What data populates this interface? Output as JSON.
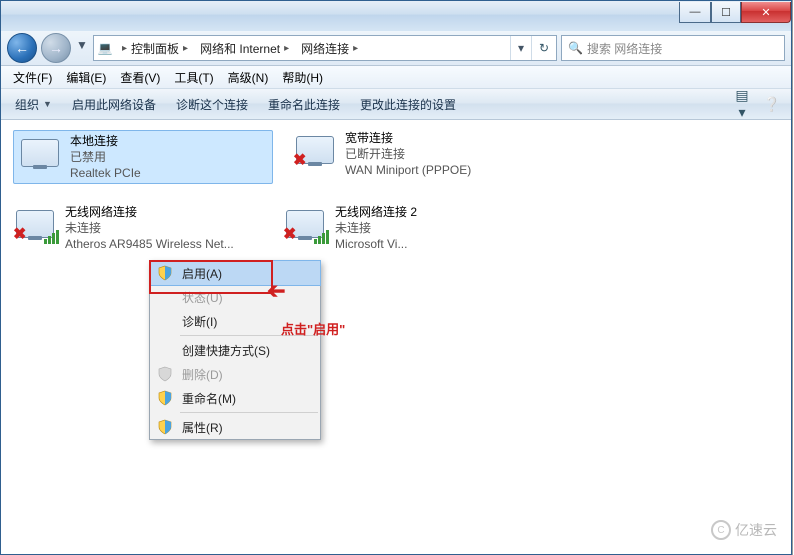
{
  "titlebar": {
    "min": "—",
    "max": "☐",
    "close": "✕"
  },
  "nav": {
    "back_glyph": "←",
    "fwd_glyph": "→",
    "drop_glyph": "▼",
    "icon": "💻",
    "refresh": "↻",
    "split": "▾"
  },
  "breadcrumbs": [
    {
      "label": "控制面板"
    },
    {
      "label": "网络和 Internet"
    },
    {
      "label": "网络连接"
    }
  ],
  "search": {
    "placeholder": "搜索 网络连接",
    "icon": "🔍"
  },
  "menubar": [
    {
      "label": "文件(F)"
    },
    {
      "label": "编辑(E)"
    },
    {
      "label": "查看(V)"
    },
    {
      "label": "工具(T)"
    },
    {
      "label": "高级(N)"
    },
    {
      "label": "帮助(H)"
    }
  ],
  "toolbar": {
    "organize": "组织",
    "enable": "启用此网络设备",
    "diagnose": "诊断这个连接",
    "rename": "重命名此连接",
    "change": "更改此连接的设置",
    "view_icon": "▤",
    "help_icon": "❔"
  },
  "connections": [
    {
      "name": "本地连接",
      "status": "已禁用",
      "device": "Realtek PCIe",
      "signal": false,
      "x": false,
      "selected": true
    },
    {
      "name": "宽带连接",
      "status": "已断开连接",
      "device": "WAN Miniport (PPPOE)",
      "signal": false,
      "x": true,
      "selected": false
    },
    {
      "name": "无线网络连接",
      "status": "未连接",
      "device": "Atheros AR9485 Wireless Net...",
      "signal": true,
      "x": true,
      "selected": false
    },
    {
      "name": "无线网络连接 2",
      "status": "未连接",
      "device": "Microsoft Vi...",
      "signal": true,
      "x": true,
      "selected": false
    }
  ],
  "context_menu": [
    {
      "label": "启用(A)",
      "shield": true,
      "disabled": false,
      "highlight": true
    },
    {
      "label": "状态(U)",
      "shield": false,
      "disabled": true
    },
    {
      "label": "诊断(I)",
      "shield": false,
      "disabled": false
    },
    {
      "sep": true
    },
    {
      "label": "创建快捷方式(S)",
      "shield": false,
      "disabled": false
    },
    {
      "label": "删除(D)",
      "shield": true,
      "disabled": true
    },
    {
      "label": "重命名(M)",
      "shield": true,
      "disabled": false
    },
    {
      "sep": true
    },
    {
      "label": "属性(R)",
      "shield": true,
      "disabled": false
    }
  ],
  "annotation": {
    "text": "点击\"启用\"",
    "arrow": "➔"
  },
  "watermark": {
    "text": "亿速云",
    "c": "C"
  }
}
